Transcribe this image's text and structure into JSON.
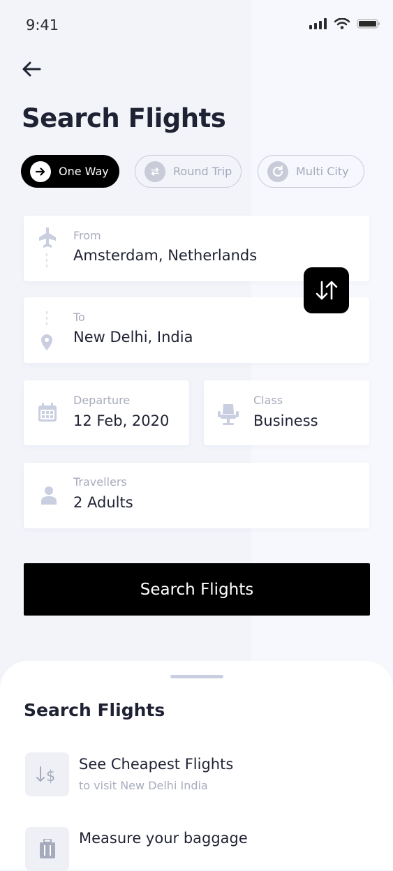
{
  "status": {
    "time": "9:41"
  },
  "header": {
    "title": "Search Flights"
  },
  "trip_types": [
    {
      "label": "One Way",
      "selected": true
    },
    {
      "label": "Round Trip",
      "selected": false
    },
    {
      "label": "Multi City",
      "selected": false
    }
  ],
  "form": {
    "from": {
      "label": "From",
      "value": "Amsterdam, Netherlands"
    },
    "to": {
      "label": "To",
      "value": "New Delhi, India"
    },
    "departure": {
      "label": "Departure",
      "value": "12 Feb, 2020"
    },
    "class": {
      "label": "Class",
      "value": "Business"
    },
    "travellers": {
      "label": "Travellers",
      "value": "2 Adults"
    }
  },
  "actions": {
    "search_label": "Search Flights"
  },
  "sheet": {
    "title": "Search Flights",
    "options": [
      {
        "title": "See Cheapest Flights",
        "subtitle": "to visit New Delhi India",
        "icon": "cheapest-icon"
      },
      {
        "title": "Measure your baggage",
        "subtitle": "",
        "icon": "baggage-icon"
      }
    ]
  },
  "colors": {
    "accent": "#000000",
    "muted": "#a8acbd",
    "icon": "#c9cfe0",
    "background": "#f2f4fa"
  }
}
